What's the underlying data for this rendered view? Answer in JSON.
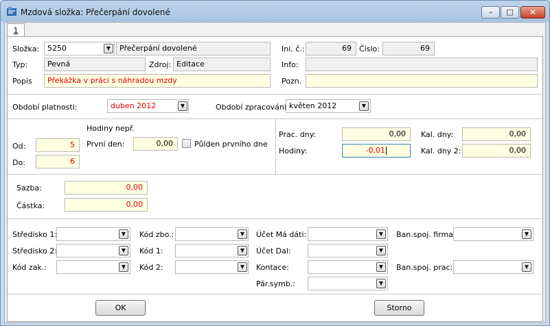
{
  "window": {
    "title": "Mzdová složka: Přečerpání dovolené"
  },
  "tabs": [
    {
      "label": "1"
    }
  ],
  "header": {
    "slozka_label": "Složka:",
    "slozka_code": "5250",
    "slozka_name": "Přečerpání dovolené",
    "typ_label": "Typ:",
    "typ_value": "Pevná",
    "zdroj_label": "Zdroj:",
    "zdroj_value": "Editace",
    "popis_label": "Popis",
    "popis_value": "Překážka v práci s náhradou mzdy",
    "inic_label": "Ini. č.:",
    "inic_value": "69",
    "cislo_label": "Číslo:",
    "cislo_value": "69",
    "info_label": "Info:",
    "info_value": "",
    "pozn_label": "Pozn.",
    "pozn_value": ""
  },
  "period": {
    "platnosti_label": "Období platnosti:",
    "platnosti_value": "duben 2012",
    "zpracovani_label": "Období zpracování:",
    "zpracovani_value": "květen 2012"
  },
  "hours": {
    "hodiny_nepr_label": "Hodiny nepř.",
    "od_label": "Od:",
    "od_value": "5",
    "do_label": "Do:",
    "do_value": "6",
    "prvni_den_label": "První den:",
    "prvni_den_value": "0,00",
    "pulden_label": "Půlden prvního dne",
    "prac_dny_label": "Prac. dny:",
    "prac_dny_value": "0,00",
    "hodiny_label": "Hodiny:",
    "hodiny_value": "-0,01",
    "kal_dny_label": "Kal. dny:",
    "kal_dny_value": "0,00",
    "kal_dny2_label": "Kal. dny 2:",
    "kal_dny2_value": "0,00"
  },
  "amounts": {
    "sazba_label": "Sazba:",
    "sazba_value": "0,00",
    "castka_label": "Částka:",
    "castka_value": "0,00"
  },
  "accounting": {
    "stredisko1_label": "Středisko 1:",
    "stredisko2_label": "Středisko 2:",
    "kod_zak_label": "Kód zak.:",
    "kod_zbo_label": "Kód zbo.:",
    "kod1_label": "Kód 1:",
    "kod2_label": "Kód 2:",
    "ucet_ma_dati_label": "Účet Má dáti:",
    "ucet_dal_label": "Účet Dal:",
    "kontace_label": "Kontace:",
    "par_symb_label": "Pár.symb.:",
    "ban_firma_label": "Ban.spoj. firma:",
    "ban_prac_label": "Ban.spoj. prac:"
  },
  "buttons": {
    "ok": "OK",
    "storno": "Storno"
  },
  "icons": {
    "dropdown": "▼",
    "minimize": "–",
    "maximize": "□",
    "close": "✕"
  }
}
